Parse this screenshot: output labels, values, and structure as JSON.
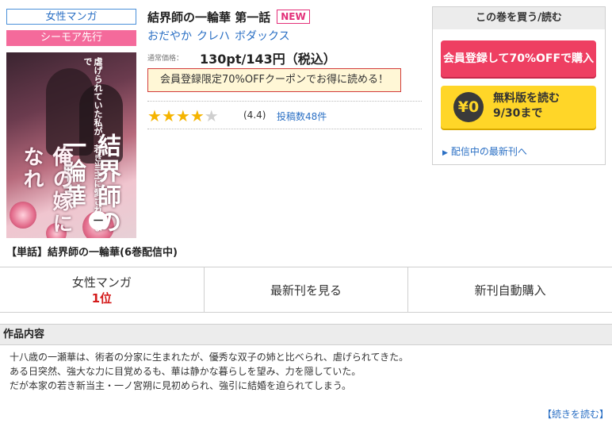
{
  "tags": {
    "genre": "女性マンガ",
    "lead": "シーモア先行"
  },
  "cover": {
    "title_text": "結界師の一輪華",
    "sub_text": "俺の嫁になれ",
    "top_text": "虐げられていた私が、若き当主に愛されるまで",
    "volume": "一"
  },
  "book": {
    "title": "結界師の一輪華 第一話",
    "new_badge": "NEW",
    "authors": [
      "おだやか",
      "クレハ",
      "ボダックス"
    ],
    "price_label": "通常価格：",
    "price": "130pt/143円（税込）",
    "coupon": "会員登録限定70%OFFクーポンでお得に読める！",
    "rating_value": 4.4,
    "rating_text": "(4.4)",
    "reviews": "投稿数48件",
    "series": "【単話】結界師の一輪華(6巻配信中)"
  },
  "buy": {
    "header": "この巻を買う/読む",
    "register_button": "会員登録して70%OFFで購入",
    "free_icon": "¥0",
    "free_line1": "無料版を読む",
    "free_line2": "9/30まで",
    "latest_link": "配信中の最新刊へ"
  },
  "tabs": {
    "ranking_label": "女性マンガ",
    "ranking_value": "1位",
    "latest": "最新刊を見る",
    "auto": "新刊自動購入"
  },
  "content": {
    "header": "作品内容",
    "lines": [
      "十八歳の一瀬華は、術者の分家に生まれたが、優秀な双子の姉と比べられ、虐げられてきた。",
      "ある日突然、強大な力に目覚めるも、華は静かな暮らしを望み、力を隠していた。",
      "だが本家の若き新当主・一ノ宮朔に見初められ、強引に結婚を迫られてしまう。"
    ],
    "more": "【続きを読む】"
  },
  "colors": {
    "accent_pink": "#ee3f62",
    "accent_yellow": "#ffd628",
    "link_blue": "#2a6fc4",
    "rank_red": "#d41a1a"
  }
}
